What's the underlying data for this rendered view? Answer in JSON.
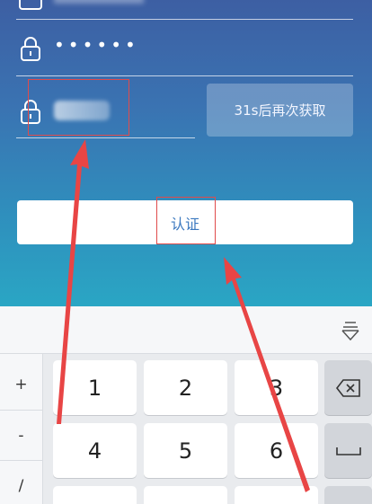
{
  "form": {
    "password_mask": "••••••",
    "resend_label": "31s后再次获取",
    "submit_label": "认证"
  },
  "keyboard": {
    "symbols": [
      "+",
      "-",
      "/"
    ],
    "digit_keys": [
      "1",
      "2",
      "3",
      "4",
      "5",
      "6"
    ]
  },
  "colors": {
    "gradient_top": "#3d5fa3",
    "gradient_bottom": "#2aa6c4",
    "submit_text": "#3b78bf",
    "annotation_red": "#e04b4b",
    "keyboard_bg": "#e9ebee"
  },
  "icons": [
    "user-icon",
    "lock-icon",
    "lock-icon",
    "collapse-keyboard-icon",
    "backspace-icon",
    "space-icon"
  ]
}
